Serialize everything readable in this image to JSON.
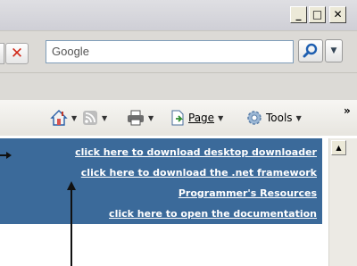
{
  "window": {
    "minimize_glyph": "_",
    "maximize_glyph": "□",
    "close_glyph": "✕"
  },
  "navbar": {
    "stop_glyph": "✕",
    "search": {
      "placeholder": "Google",
      "value": ""
    },
    "search_go_icon": "search-icon"
  },
  "command_bar": {
    "page_label": "Page",
    "tools_label": "Tools",
    "overflow_glyph": "»"
  },
  "links": [
    "click here to download desktop downloader",
    "click here to download the .net framework",
    "Programmer's Resources",
    "click here to open the documentation"
  ],
  "colors": {
    "panel_background": "#3b6a9a",
    "link_text": "#ffffff"
  }
}
